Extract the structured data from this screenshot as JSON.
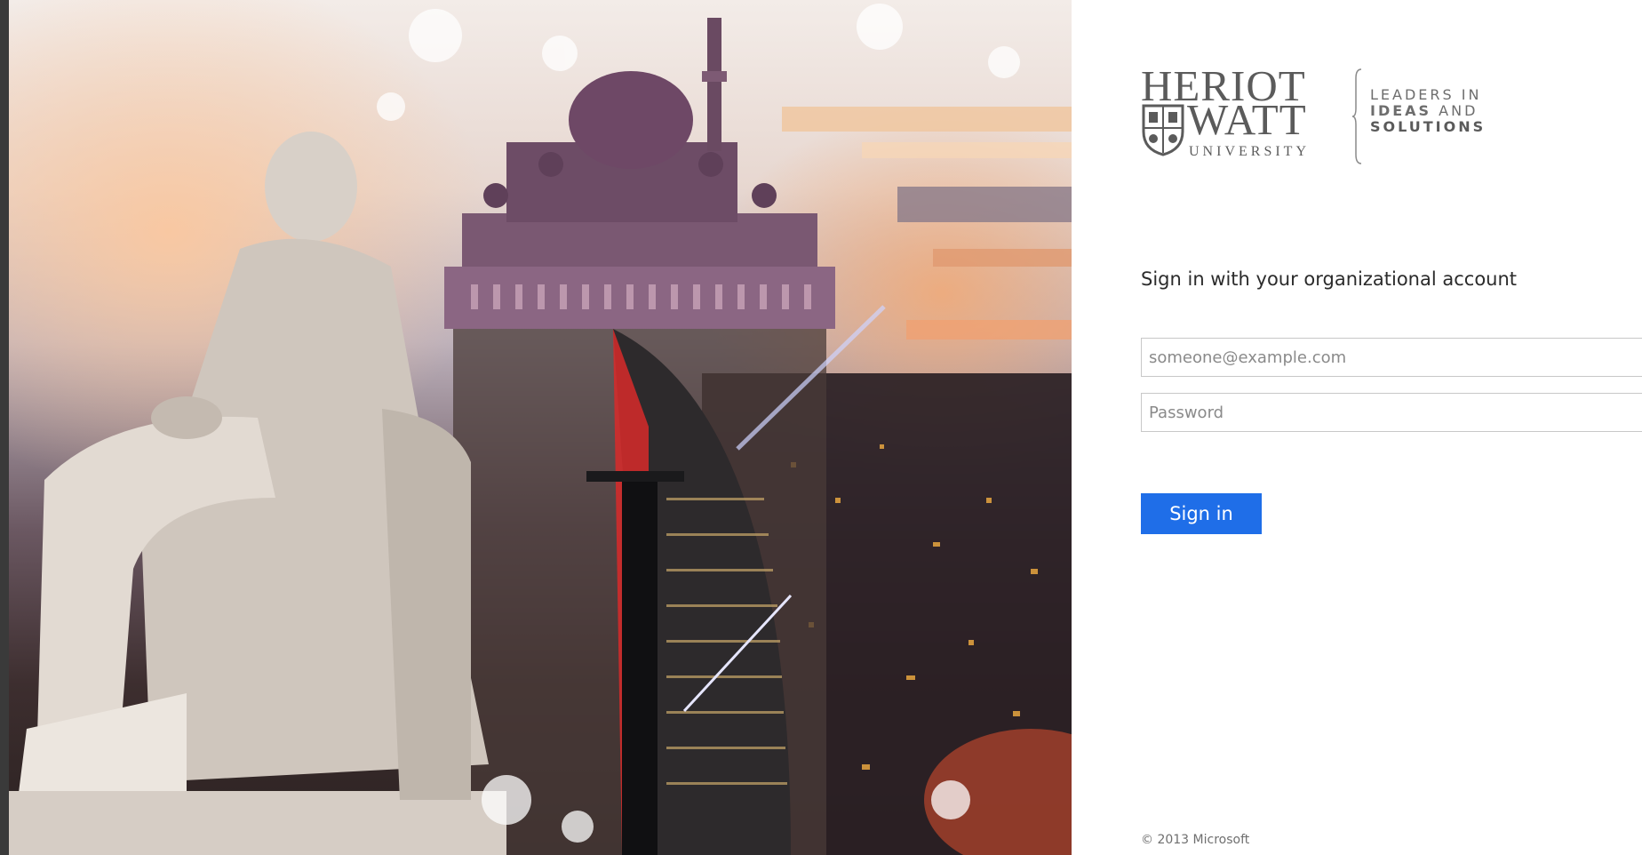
{
  "illustration": {
    "description_icon": "campus-collage-image"
  },
  "branding": {
    "name_line1": "HERIOT",
    "name_line2": "WATT",
    "name_line3": "UNIVERSITY",
    "tagline_line1": "LEADERS IN",
    "tagline_line2": "IDEAS",
    "tagline_line2b": "AND",
    "tagline_line3": "SOLUTIONS"
  },
  "form": {
    "heading": "Sign in with your organizational account",
    "email_placeholder": "someone@example.com",
    "email_value": "",
    "password_placeholder": "Password",
    "password_value": "",
    "submit_label": "Sign in"
  },
  "footer": {
    "copyright": "© 2013 Microsoft"
  },
  "colors": {
    "accent": "#1f6ee8",
    "panel_bg": "#ffffff",
    "frame_bg": "#3a3a3a"
  }
}
